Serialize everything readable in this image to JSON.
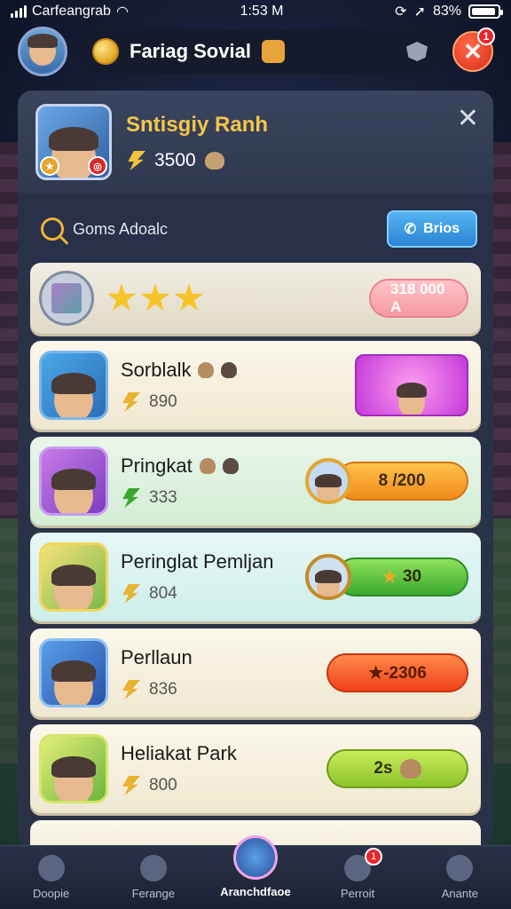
{
  "status": {
    "carrier": "Carfeangrab",
    "time": "1:53 M",
    "battery": "83%"
  },
  "header": {
    "title": "Fariag Sovial",
    "badge_count": "1"
  },
  "profile": {
    "name": "Sntisgiy Ranh",
    "score": "3500"
  },
  "search": {
    "placeholder": "Goms Adoalc",
    "button_label": "Brios"
  },
  "leaderboard": {
    "header_pill": "318 000 A",
    "rows": [
      {
        "name": "Sorblalk",
        "score": "890",
        "reward": ""
      },
      {
        "name": "Pringkat",
        "score": "333",
        "reward": "8 /200"
      },
      {
        "name": "Peringlat Pemljan",
        "score": "804",
        "reward": "30"
      },
      {
        "name": "Perllaun",
        "score": "836",
        "reward": "★-2306"
      },
      {
        "name": "Heliakat Park",
        "score": "800",
        "reward": "2s"
      }
    ]
  },
  "nav": {
    "items": [
      {
        "label": "Doopie"
      },
      {
        "label": "Ferange"
      },
      {
        "label": "Aranchdfaoe"
      },
      {
        "label": "Perroit",
        "badge": "1"
      },
      {
        "label": "Anante"
      }
    ]
  },
  "colors": {
    "accent_gold": "#f3c64b",
    "button_blue": "#2a84d3",
    "close_red": "#d92b1a"
  }
}
